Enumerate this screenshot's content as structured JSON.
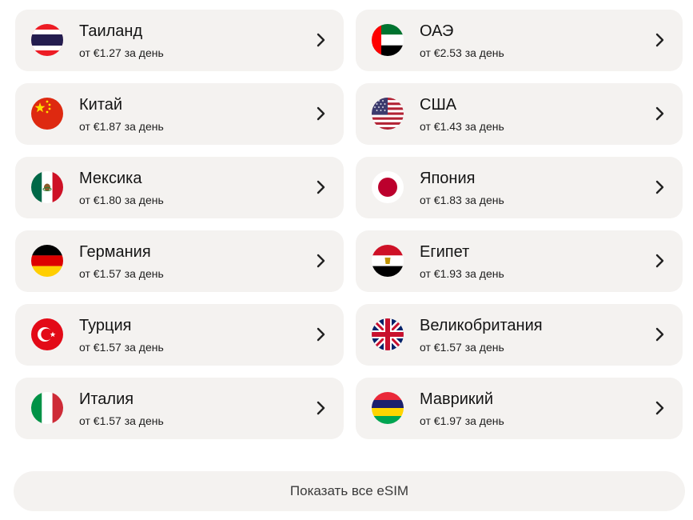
{
  "countries": [
    {
      "name": "Таиланд",
      "price": "от €1.27 за день",
      "flag_icon": "thailand-flag-icon"
    },
    {
      "name": "ОАЭ",
      "price": "от €2.53 за день",
      "flag_icon": "uae-flag-icon"
    },
    {
      "name": "Китай",
      "price": "от €1.87 за день",
      "flag_icon": "china-flag-icon"
    },
    {
      "name": "США",
      "price": "от €1.43 за день",
      "flag_icon": "usa-flag-icon"
    },
    {
      "name": "Мексика",
      "price": "от €1.80 за день",
      "flag_icon": "mexico-flag-icon"
    },
    {
      "name": "Япония",
      "price": "от €1.83 за день",
      "flag_icon": "japan-flag-icon"
    },
    {
      "name": "Германия",
      "price": "от €1.57 за день",
      "flag_icon": "germany-flag-icon"
    },
    {
      "name": "Египет",
      "price": "от €1.93 за день",
      "flag_icon": "egypt-flag-icon"
    },
    {
      "name": "Турция",
      "price": "от €1.57 за день",
      "flag_icon": "turkey-flag-icon"
    },
    {
      "name": "Великобритания",
      "price": "от €1.57 за день",
      "flag_icon": "uk-flag-icon"
    },
    {
      "name": "Италия",
      "price": "от €1.57 за день",
      "flag_icon": "italy-flag-icon"
    },
    {
      "name": "Маврикий",
      "price": "от €1.97 за день",
      "flag_icon": "mauritius-flag-icon"
    }
  ],
  "show_all_label": "Показать все eSIM",
  "colors": {
    "card_bg": "#f4f2f0",
    "text": "#141414"
  }
}
